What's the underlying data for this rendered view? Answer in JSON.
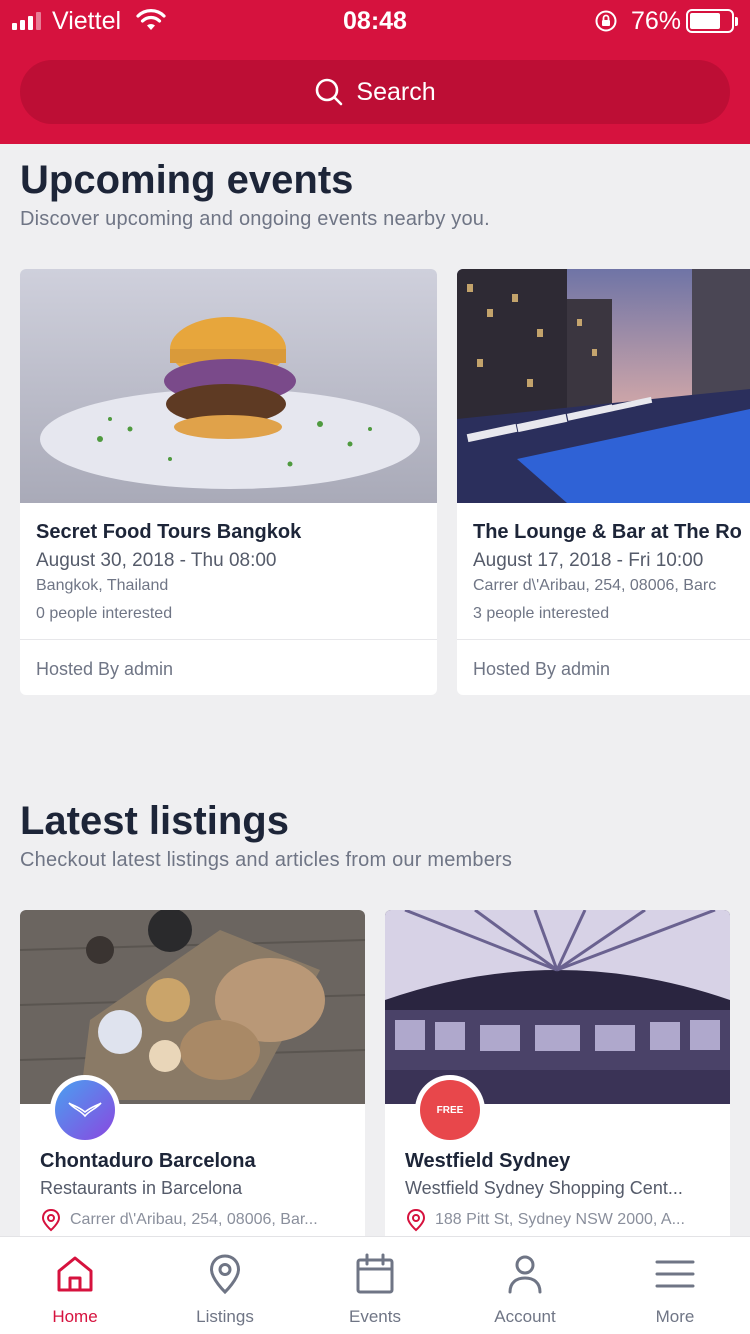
{
  "status_bar": {
    "carrier": "Viettel",
    "time": "08:48",
    "battery": "76%",
    "battery_level": 0.76
  },
  "search": {
    "label": "Search"
  },
  "events": {
    "title": "Upcoming events",
    "subtitle": "Discover upcoming and ongoing events nearby you.",
    "items": [
      {
        "title": "Secret Food Tours Bangkok",
        "date": "August 30, 2018 - Thu 08:00",
        "location": "Bangkok, Thailand",
        "interested": "0 people interested",
        "host": "Hosted By admin"
      },
      {
        "title": "The Lounge & Bar at The Ro",
        "date": "August 17, 2018 - Fri 10:00",
        "location": "Carrer d\\'Aribau, 254, 08006, Barc",
        "interested": "3 people interested",
        "host": "Hosted By admin"
      }
    ]
  },
  "listings": {
    "title": "Latest listings",
    "subtitle": "Checkout latest listings and articles from our members",
    "items": [
      {
        "title": "Chontaduro Barcelona",
        "category": "Restaurants in Barcelona",
        "address": "Carrer d\\'Aribau, 254, 08006, Bar...",
        "avatar_color": "#6a63e6"
      },
      {
        "title": "Westfield Sydney",
        "category": "Westfield Sydney Shopping Cent...",
        "address": "188 Pitt St, Sydney NSW 2000, A...",
        "avatar_color": "#e8474b",
        "avatar_text": "FREE"
      }
    ]
  },
  "tabs": [
    {
      "label": "Home",
      "icon": "home-icon",
      "active": true
    },
    {
      "label": "Listings",
      "icon": "map-pin-icon",
      "active": false
    },
    {
      "label": "Events",
      "icon": "calendar-icon",
      "active": false
    },
    {
      "label": "Account",
      "icon": "user-icon",
      "active": false
    },
    {
      "label": "More",
      "icon": "menu-icon",
      "active": false
    }
  ],
  "colors": {
    "brand": "#d6123e",
    "search_bg": "#bd0e35",
    "background": "#efeff1",
    "text_dark": "#1d2538",
    "text_muted": "#6f7585"
  }
}
